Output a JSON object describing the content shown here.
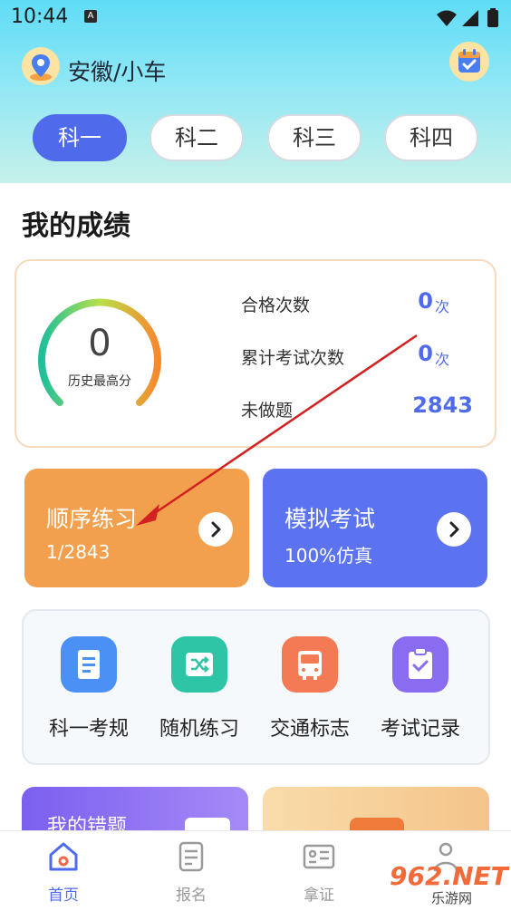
{
  "status_bar": {
    "time": "10:44",
    "notif_badge": "A"
  },
  "header": {
    "location": "安徽/小车",
    "tabs": [
      {
        "label": "科一",
        "active": true
      },
      {
        "label": "科二",
        "active": false
      },
      {
        "label": "科三",
        "active": false
      },
      {
        "label": "科四",
        "active": false
      }
    ]
  },
  "scores": {
    "title": "我的成绩",
    "best_score": "0",
    "best_score_label": "历史最高分",
    "pass_count_label": "合格次数",
    "pass_count": "0",
    "pass_count_unit": "次",
    "total_exams_label": "累计考试次数",
    "total_exams": "0",
    "total_exams_unit": "次",
    "undone_label": "未做题",
    "undone": "2843"
  },
  "practice": {
    "sequential_title": "顺序练习",
    "sequential_progress": "1/2843",
    "mock_title": "模拟考试",
    "mock_sub": "100%仿真"
  },
  "tools": [
    {
      "label": "科一考规",
      "icon": "document-icon",
      "color": "#4a90f5"
    },
    {
      "label": "随机练习",
      "icon": "shuffle-icon",
      "color": "#2ec4a6"
    },
    {
      "label": "交通标志",
      "icon": "bus-icon",
      "color": "#f47a55"
    },
    {
      "label": "考试记录",
      "icon": "clipboard-check-icon",
      "color": "#8a6cf0"
    }
  ],
  "bottom_cards": {
    "wrong_title": "我的错题"
  },
  "nav": [
    {
      "label": "首页",
      "active": true
    },
    {
      "label": "报名",
      "active": false
    },
    {
      "label": "拿证",
      "active": false
    },
    {
      "label": "",
      "active": false
    }
  ],
  "watermark": {
    "brand": "962.NET",
    "sub": "乐游网"
  },
  "colors": {
    "accent": "#4f6bec",
    "sequential_card": "#f2a04e",
    "mock_card": "#5b73f0"
  }
}
